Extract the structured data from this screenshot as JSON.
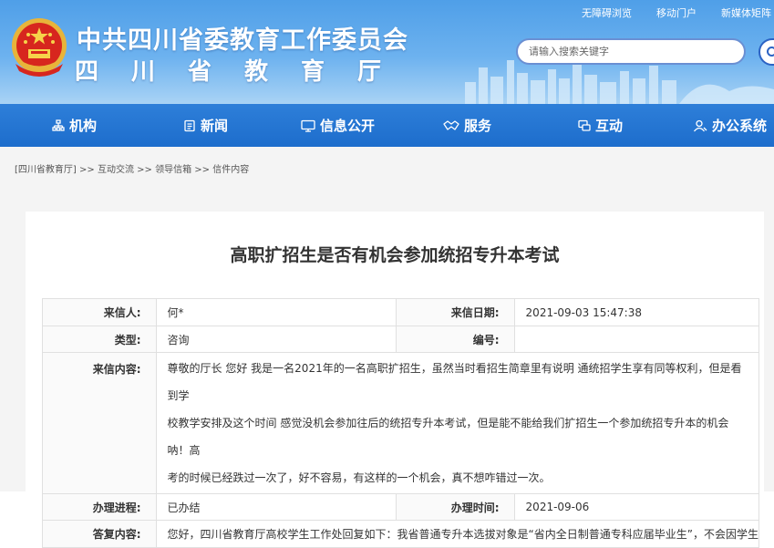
{
  "header": {
    "title": "中共四川省委教育工作委员会",
    "subtitle": "四川省教育厅",
    "top_links": [
      "无障碍浏览",
      "移动门户",
      "新媒体矩阵"
    ],
    "search_placeholder": "请输入搜索关键字"
  },
  "nav": {
    "items": [
      {
        "label": "机构",
        "icon": "org-icon"
      },
      {
        "label": "新闻",
        "icon": "news-icon"
      },
      {
        "label": "信息公开",
        "icon": "monitor-icon"
      },
      {
        "label": "服务",
        "icon": "handshake-icon"
      },
      {
        "label": "互动",
        "icon": "chat-icon"
      },
      {
        "label": "办公系统",
        "icon": "user-icon"
      }
    ]
  },
  "breadcrumb": {
    "items": [
      "[四川省教育厅]",
      "互动交流",
      "领导信箱",
      "信件内容"
    ],
    "separator": ">>"
  },
  "letter": {
    "title": "高职扩招生是否有机会参加统招专升本考试",
    "sender_label": "来信人:",
    "sender": "何*",
    "date_label": "来信日期:",
    "date": "2021-09-03 15:47:38",
    "type_label": "类型:",
    "type": "咨询",
    "number_label": "编号:",
    "number": "",
    "content_label": "来信内容:",
    "content_lines": [
      "尊敬的厅长 您好 我是一名2021年的一名高职扩招生，虽然当时看招生简章里有说明 通统招学生享有同等权利，但是看到学",
      "校教学安排及这个时间 感觉没机会参加往后的统招专升本考试，但是能不能给我们扩招生一个参加统招专升本的机会呐！高",
      "考的时候已经跌过一次了，好不容易，有这样的一个机会，真不想咋错过一次。"
    ],
    "progress_label": "办理进程:",
    "progress": "已办结",
    "handle_time_label": "办理时间:",
    "handle_time": "2021-09-06",
    "reply_label": "答复内容:",
    "reply_line": "您好，四川省教育厅高校学生工作处回复如下：我省普通专升本选拔对象是“省内全日制普通专科应届毕业生”，不会因学生"
  }
}
